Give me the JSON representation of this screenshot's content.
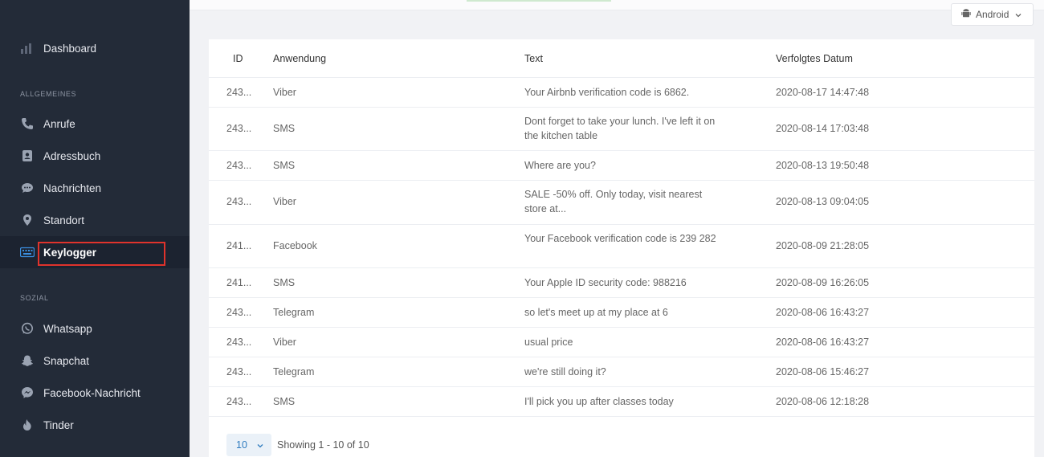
{
  "sidebar": {
    "dashboard": "Dashboard",
    "section_general": "ALLGEMEINES",
    "section_social": "SOZIAL",
    "items_general": [
      "Anrufe",
      "Adressbuch",
      "Nachrichten",
      "Standort",
      "Keylogger"
    ],
    "items_social": [
      "Whatsapp",
      "Snapchat",
      "Facebook-Nachricht",
      "Tinder"
    ],
    "active": "Keylogger",
    "icon_color": "#9aa3b2"
  },
  "topbar": {
    "os_select": "Android"
  },
  "table": {
    "headers": {
      "id": "ID",
      "app": "Anwendung",
      "text": "Text",
      "date": "Verfolgtes Datum"
    },
    "rows": [
      {
        "id": "243...",
        "app": "Viber",
        "text": "Your Airbnb verification code is 6862.",
        "date": "2020-08-17 14:47:48"
      },
      {
        "id": "243...",
        "app": "SMS",
        "text": "Dont forget to take your lunch. I've left it on the kitchen table",
        "date": "2020-08-14 17:03:48"
      },
      {
        "id": "243...",
        "app": "SMS",
        "text": "Where are you?",
        "date": "2020-08-13 19:50:48"
      },
      {
        "id": "243...",
        "app": "Viber",
        "text": "SALE -50% off. Only today, visit nearest store at...",
        "date": "2020-08-13 09:04:05"
      },
      {
        "id": "241...",
        "app": "Facebook",
        "text": "Your Facebook verification code is 239 282",
        "date": "2020-08-09 21:28:05"
      },
      {
        "id": "241...",
        "app": "SMS",
        "text": "Your Apple ID security code: 988216",
        "date": "2020-08-09 16:26:05"
      },
      {
        "id": "243...",
        "app": "Telegram",
        "text": "so let's meet up at my place at 6",
        "date": "2020-08-06 16:43:27"
      },
      {
        "id": "243...",
        "app": "Viber",
        "text": "usual price",
        "date": "2020-08-06 16:43:27"
      },
      {
        "id": "243...",
        "app": "Telegram",
        "text": "we're still doing it?",
        "date": "2020-08-06 15:46:27"
      },
      {
        "id": "243...",
        "app": "SMS",
        "text": "I'll pick you up after classes today",
        "date": "2020-08-06 12:18:28"
      }
    ]
  },
  "pagination": {
    "page_size": "10",
    "showing": "Showing 1 - 10 of 10"
  }
}
